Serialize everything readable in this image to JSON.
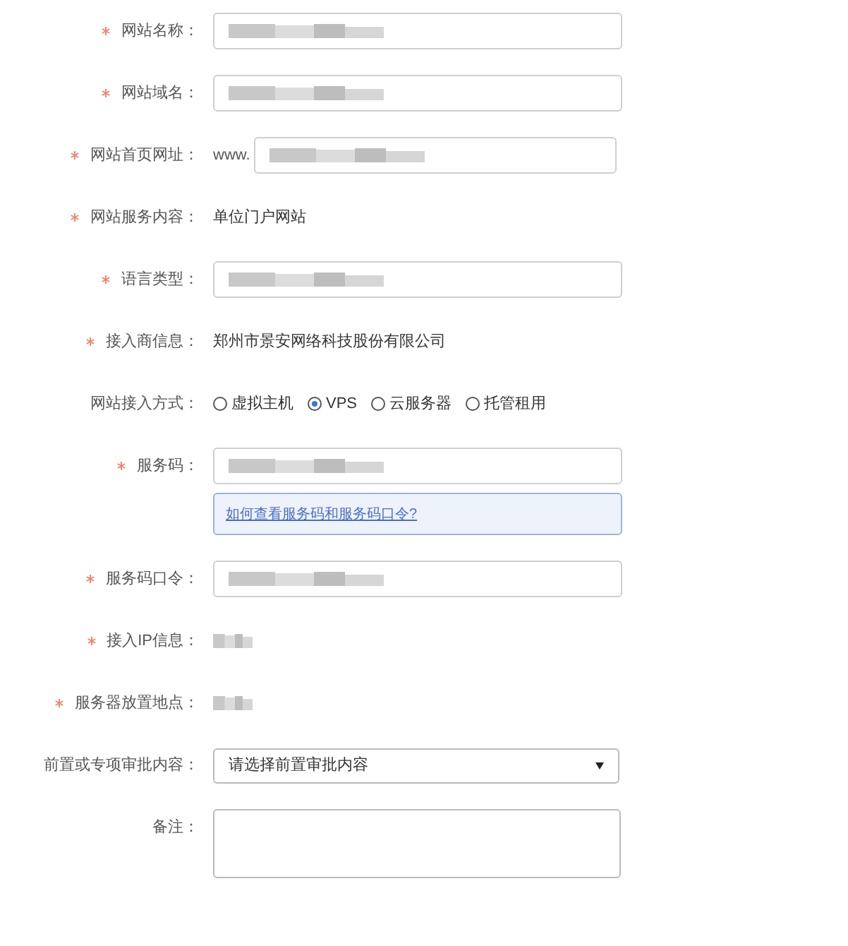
{
  "fields": [
    {
      "kind": "input",
      "label": "网站名称：",
      "required": true,
      "redacted": true
    },
    {
      "kind": "input",
      "label": "网站域名：",
      "required": true,
      "redacted": true
    },
    {
      "kind": "prefixed-input",
      "label": "网站首页网址：",
      "required": true,
      "prefix": "www.",
      "redacted": true
    },
    {
      "kind": "text",
      "label": "网站服务内容：",
      "required": true,
      "value": "单位门户网站"
    },
    {
      "kind": "input",
      "label": "语言类型：",
      "required": true,
      "redacted": true
    },
    {
      "kind": "text",
      "label": "接入商信息：",
      "required": true,
      "value": "郑州市景安网络科技股份有限公司"
    },
    {
      "kind": "radio",
      "label": "网站接入方式：",
      "required": false,
      "options": [
        {
          "label": "虚拟主机",
          "selected": false
        },
        {
          "label": "VPS",
          "selected": true
        },
        {
          "label": "云服务器",
          "selected": false
        },
        {
          "label": "托管租用",
          "selected": false
        }
      ]
    },
    {
      "kind": "input",
      "label": "服务码：",
      "required": true,
      "redacted": true,
      "hint_link": "如何查看服务码和服务码口令?"
    },
    {
      "kind": "input",
      "label": "服务码口令：",
      "required": true,
      "redacted": true
    },
    {
      "kind": "redacted-text",
      "label": "接入IP信息：",
      "required": true
    },
    {
      "kind": "redacted-text",
      "label": "服务器放置地点：",
      "required": true
    },
    {
      "kind": "select",
      "label": "前置或专项审批内容：",
      "required": false,
      "value": "请选择前置审批内容"
    },
    {
      "kind": "textarea",
      "label": "备注：",
      "required": false
    }
  ]
}
